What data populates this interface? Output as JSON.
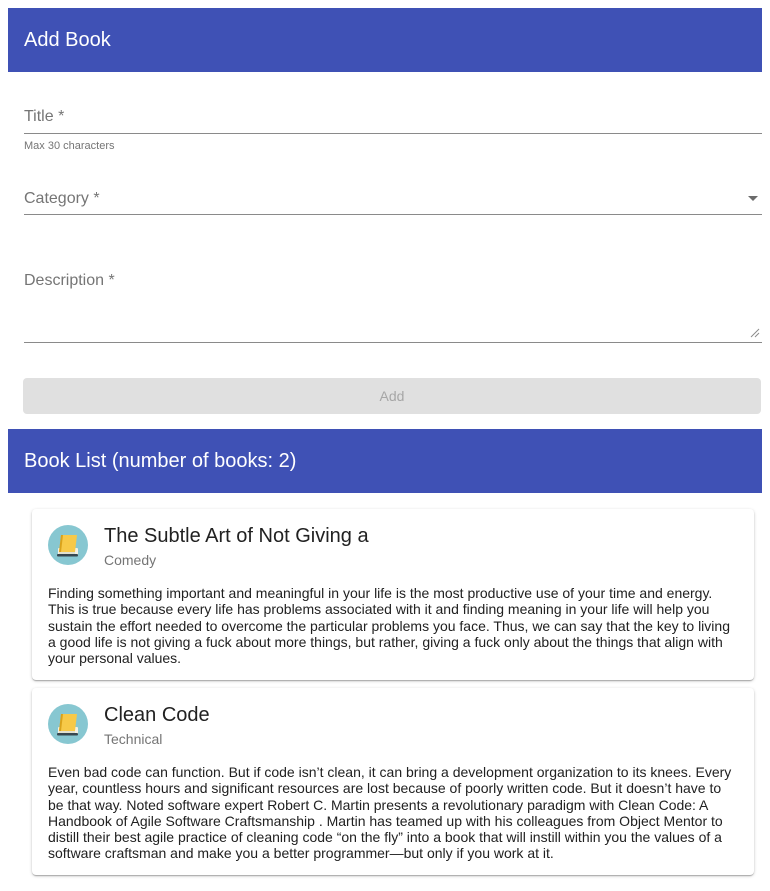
{
  "add_section": {
    "title": "Add Book",
    "title_field": {
      "label": "Title *",
      "hint": "Max 30 characters"
    },
    "category_field": {
      "label": "Category *"
    },
    "description_field": {
      "label": "Description *"
    },
    "add_button": "Add"
  },
  "list_section": {
    "title": "Book List (number of books: 2)"
  },
  "books": [
    {
      "title": "The Subtle Art of Not Giving a",
      "category": "Comedy",
      "description": "Finding something important and meaningful in your life is the most productive use of your time and energy. This is true because every life has problems associated with it and finding meaning in your life will help you sustain the effort needed to overcome the particular problems you face. Thus, we can say that the key to living a good life is not giving a fuck about more things, but rather, giving a fuck only about the things that align with your personal values.",
      "icon": "book-icon"
    },
    {
      "title": "Clean Code",
      "category": "Technical",
      "description": "Even bad code can function. But if code isn’t clean, it can bring a development organization to its knees. Every year, countless hours and significant resources are lost because of poorly written code. But it doesn’t have to be that way. Noted software expert Robert C. Martin presents a revolutionary paradigm with Clean Code: A Handbook of Agile Software Craftsmanship . Martin has teamed up with his colleagues from Object Mentor to distill their best agile practice of cleaning code “on the fly” into a book that will instill within you the values of a software craftsman and make you a better programmer—but only if you work at it.",
      "icon": "book-icon"
    }
  ],
  "colors": {
    "primary": "#3f51b5",
    "avatar_bg": "#87c7d1",
    "disabled_button": "#e0e0e0"
  }
}
